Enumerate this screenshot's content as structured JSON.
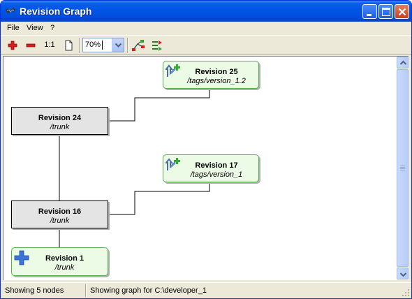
{
  "window": {
    "title": "Revision Graph",
    "title_bar_color": "#0055e5"
  },
  "menu": {
    "items": [
      "File",
      "View",
      "?"
    ]
  },
  "toolbar": {
    "zoom_in_icon": "plus-icon",
    "zoom_out_icon": "minus-icon",
    "one_to_one_label": "1:1",
    "page_icon": "page-icon",
    "zoom_value": "70%",
    "branch_icon": "branch-graph-icon",
    "compare_icon": "compare-revisions-icon"
  },
  "graph": {
    "nodes": [
      {
        "title": "Revision 25",
        "path": "/tags/version_1.2",
        "kind": "tag",
        "icon": "tag-add-icon"
      },
      {
        "title": "Revision 24",
        "path": "/trunk",
        "kind": "trunk"
      },
      {
        "title": "Revision 17",
        "path": "/tags/version_1",
        "kind": "tag",
        "icon": "tag-add-icon"
      },
      {
        "title": "Revision 16",
        "path": "/trunk",
        "kind": "trunk"
      },
      {
        "title": "Revision 1",
        "path": "/trunk",
        "kind": "add",
        "icon": "blue-plus-icon"
      }
    ],
    "colors": {
      "tag_border": "#55b24c",
      "tag_fill": "#ebfbe6",
      "trunk_fill": "#e4e4e4"
    }
  },
  "statusbar": {
    "nodes_text": "Showing 5 nodes",
    "graph_text": "Showing graph for C:\\developer_1"
  }
}
